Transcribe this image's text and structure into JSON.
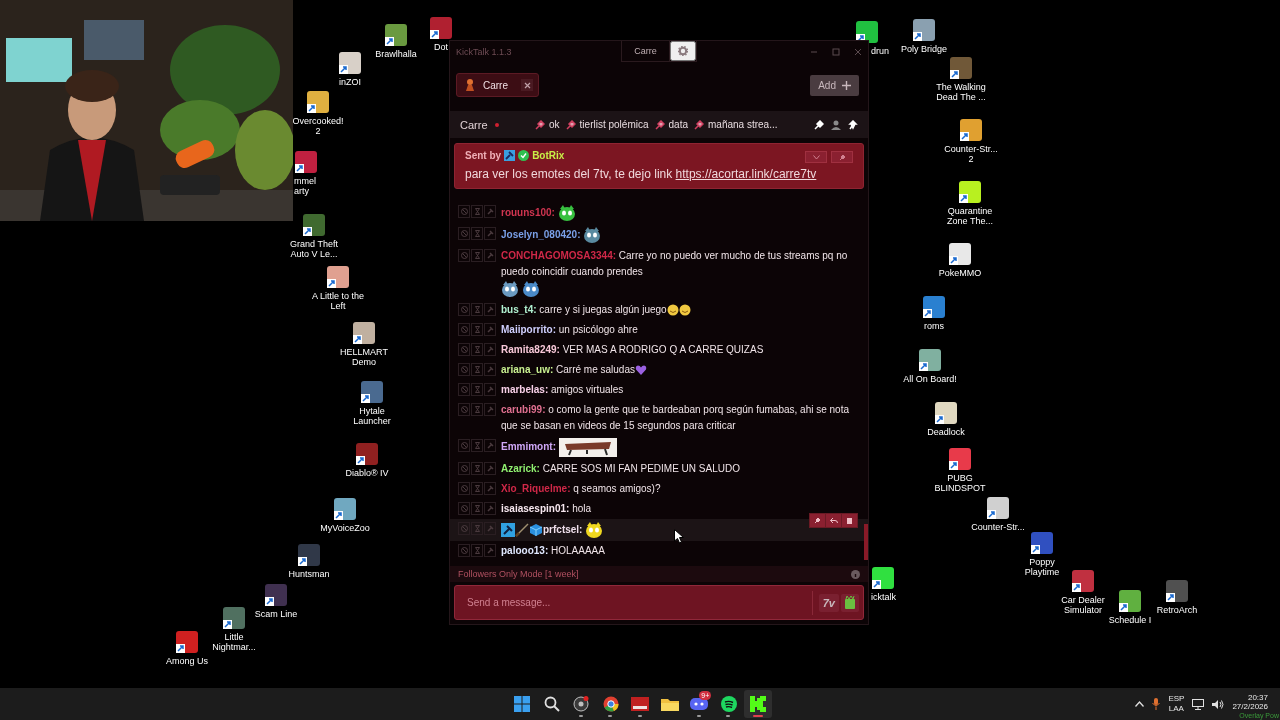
{
  "desktop_icons": [
    {
      "label": "Brawlhalla"
    },
    {
      "label": "Dot"
    },
    {
      "label": "inZOI"
    },
    {
      "label": "Overcooked!\n2"
    },
    {
      "label": "mmel\narty"
    },
    {
      "label": "Grand Theft\nAuto V Le..."
    },
    {
      "label": "A Little to the\nLeft"
    },
    {
      "label": "HELLMART\nDemo"
    },
    {
      "label": "Hytale\nLauncher"
    },
    {
      "label": "Diablo® IV"
    },
    {
      "label": "MyVoiceZoo"
    },
    {
      "label": "Huntsman"
    },
    {
      "label": "Scam Line"
    },
    {
      "label": "Little\nNightmar..."
    },
    {
      "label": "Among Us"
    },
    {
      "label": "drun"
    },
    {
      "label": "Poly Bridge"
    },
    {
      "label": "The Walking\nDead The ..."
    },
    {
      "label": "Counter-Str...\n2"
    },
    {
      "label": "Quarantine\nZone The..."
    },
    {
      "label": "PokeMMO"
    },
    {
      "label": "roms"
    },
    {
      "label": "All On Board!"
    },
    {
      "label": "Deadlock"
    },
    {
      "label": "PUBG\nBLINDSPOT"
    },
    {
      "label": "Counter-Str..."
    },
    {
      "label": "Poppy\nPlaytime"
    },
    {
      "label": "icktalk"
    },
    {
      "label": "Car Dealer\nSimulator"
    },
    {
      "label": "Schedule I"
    },
    {
      "label": "RetroArch"
    }
  ],
  "chat_window": {
    "title": "KickTalk 1.1.3",
    "header_tab": "Carre",
    "channel_tabs": [
      {
        "label": "Carre",
        "selected": true
      }
    ],
    "add_button": "Add",
    "channel_bar": {
      "name": "Carre",
      "live": true,
      "pinned_links": [
        "ok",
        "tierlist polémica",
        "data",
        "mañana strea..."
      ]
    },
    "pinned_message": {
      "sent_by": "Sent by",
      "author": "BotRix",
      "text": "para ver los emotes del 7tv, te dejo link",
      "link": "https://acortar.link/carre7tv"
    },
    "messages": [
      {
        "user": "rouuns100:",
        "color": "#d03550",
        "badges": false,
        "hovered": false,
        "parts": [
          {
            "kind": "emote"
          }
        ]
      },
      {
        "user": "Joselyn_080420:",
        "color": "#7aa0e8",
        "badges": false,
        "hovered": false,
        "parts": [
          {
            "kind": "emote"
          }
        ]
      },
      {
        "user": "CONCHAGOMOSA3344:",
        "color": "#d02848",
        "badges": false,
        "hovered": false,
        "parts": [
          {
            "kind": "text",
            "text": "Carre yo no puedo ver mucho de tus streams pq no puedo coincidir cuando prendes"
          },
          {
            "kind": "emote"
          },
          {
            "kind": "emote"
          }
        ]
      },
      {
        "user": "bus_t4:",
        "color": "#b0f0d0",
        "badges": false,
        "hovered": false,
        "parts": [
          {
            "kind": "text",
            "text": "carre y si juegas algún juego"
          },
          {
            "kind": "emoji"
          },
          {
            "kind": "emoji"
          }
        ]
      },
      {
        "user": "Maiiporrito:",
        "color": "#d0d0ff",
        "badges": false,
        "hovered": false,
        "parts": [
          {
            "kind": "text",
            "text": "un psicólogo ahre"
          }
        ]
      },
      {
        "user": "Ramita8249:",
        "color": "#f8c8d8",
        "badges": false,
        "hovered": false,
        "parts": [
          {
            "kind": "text",
            "text": "VER MAS A RODRIGO Q A CARRE QUIZAS"
          }
        ]
      },
      {
        "user": "ariana_uw:",
        "color": "#c8f090",
        "badges": false,
        "hovered": false,
        "parts": [
          {
            "kind": "text",
            "text": "Carré me saludas"
          },
          {
            "kind": "heart"
          }
        ]
      },
      {
        "user": "marbelas:",
        "color": "#f8d0e8",
        "badges": false,
        "hovered": false,
        "parts": [
          {
            "kind": "text",
            "text": "amigos virtuales"
          }
        ]
      },
      {
        "user": "carubi99:",
        "color": "#e07090",
        "badges": false,
        "hovered": false,
        "parts": [
          {
            "kind": "text",
            "text": "o como la gente que te bardeaban porq según fumabas, ahi se nota que se basan en videos de 15 segundos para criticar"
          }
        ]
      },
      {
        "user": "Emmimont:",
        "color": "#d0a8f8",
        "badges": false,
        "hovered": false
      },
      {
        "user": "Azarick:",
        "color": "#90f070",
        "badges": false,
        "hovered": false,
        "parts": [
          {
            "kind": "text",
            "text": "CARRE SOS MI FAN PEDIME UN SALUDO"
          }
        ]
      },
      {
        "user": "Xio_Riquelme:",
        "color": "#d02848",
        "badges": false,
        "hovered": false,
        "parts": [
          {
            "kind": "text",
            "text": "q seamos amigos)?"
          }
        ]
      },
      {
        "user": "isaiasespin01:",
        "color": "#f8e8f0",
        "badges": false,
        "hovered": false,
        "parts": [
          {
            "kind": "text",
            "text": "hola"
          }
        ]
      },
      {
        "user": "prfctsel:",
        "color": "#f0e0ec",
        "badges": true,
        "hovered": true,
        "parts": [
          {
            "kind": "emote"
          }
        ]
      },
      {
        "user": "palooo13:",
        "color": "#e0e8ff",
        "badges": false,
        "hovered": false,
        "parts": [
          {
            "kind": "text",
            "text": "HOLAAAAA"
          }
        ]
      }
    ],
    "footer": "Followers Only Mode [1 week]",
    "input": {
      "placeholder": "Send a message...",
      "emote_provider": "7v"
    }
  },
  "taskbar": {
    "apps": [
      {
        "running": false,
        "active": false
      },
      {
        "running": false,
        "active": false
      },
      {
        "running": true,
        "active": false
      },
      {
        "running": true,
        "active": false
      },
      {
        "running": true,
        "active": false
      },
      {
        "running": false,
        "active": false
      },
      {
        "running": true,
        "active": false,
        "badge": "9+"
      },
      {
        "running": true,
        "active": false
      },
      {
        "running": true,
        "active": true
      }
    ],
    "language": [
      "ESP",
      "LAA"
    ],
    "time": "20:37",
    "date": "27/2/2026",
    "overlay_text": "Overlay Pow"
  }
}
